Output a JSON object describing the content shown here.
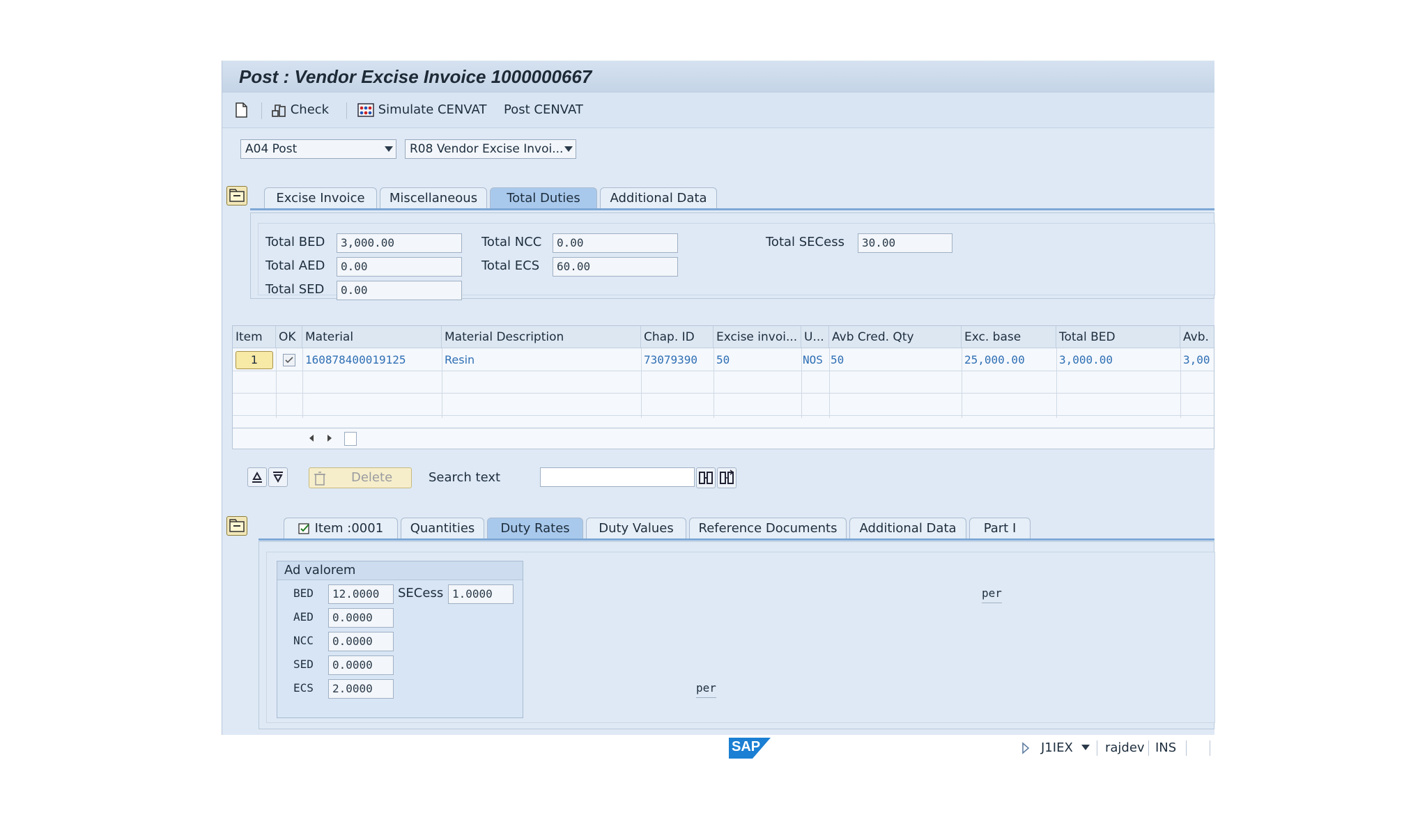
{
  "window": {
    "title": "Post : Vendor Excise Invoice 1000000667"
  },
  "toolbar": {
    "check": "Check",
    "simulate": "Simulate CENVAT",
    "post": "Post CENVAT"
  },
  "selectors": {
    "action": "A04 Post",
    "reference": "R08 Vendor Excise Invoi..."
  },
  "header_tabs": [
    "Excise Invoice",
    "Miscellaneous",
    "Total Duties",
    "Additional Data"
  ],
  "totals": {
    "bed_label": "Total BED",
    "bed": "3,000.00",
    "aed_label": "Total AED",
    "aed": "0.00",
    "sed_label": "Total SED",
    "sed": "0.00",
    "ncc_label": "Total NCC",
    "ncc": "0.00",
    "ecs_label": "Total ECS",
    "ecs": "60.00",
    "secess_label": "Total SECess",
    "secess": "30.00"
  },
  "grid": {
    "columns": [
      "Item",
      "OK",
      "Material",
      "Material Description",
      "Chap. ID",
      "Excise invoi...",
      "U...",
      "Avb Cred. Qty",
      "Exc. base",
      "Total BED",
      "Avb."
    ],
    "row": {
      "item": "1",
      "material": "160878400019125",
      "description": "Resin",
      "chap_id": "73079390",
      "excise_qty": "50",
      "unit": "NOS",
      "avb_qty": "50",
      "exc_base": "25,000.00",
      "total_bed": "3,000.00",
      "avb": "3,00"
    }
  },
  "actions": {
    "delete": "Delete",
    "search_label": "Search text",
    "search_value": ""
  },
  "item_tabs": [
    "Item   :0001",
    "Quantities",
    "Duty Rates",
    "Duty Values",
    "Reference Documents",
    "Additional Data",
    "Part I"
  ],
  "ad_valorem": {
    "title": "Ad valorem",
    "bed_label": "BED",
    "bed": "12.0000",
    "secess_label": "SECess",
    "secess": "1.0000",
    "aed_label": "AED",
    "aed": "0.0000",
    "ncc_label": "NCC",
    "ncc": "0.0000",
    "sed_label": "SED",
    "sed": "0.0000",
    "ecs_label": "ECS",
    "ecs": "2.0000"
  },
  "per_labels": {
    "top": "per",
    "bottom": "per"
  },
  "status": {
    "logo": "SAP",
    "transaction": "J1IEX",
    "user": "rajdev",
    "mode": "INS"
  },
  "colors": {
    "background": "#dfe9f5",
    "active_tab": "#a9c9ec",
    "link_value": "#2f6fb5",
    "sap_blue": "#1b7fd3"
  }
}
